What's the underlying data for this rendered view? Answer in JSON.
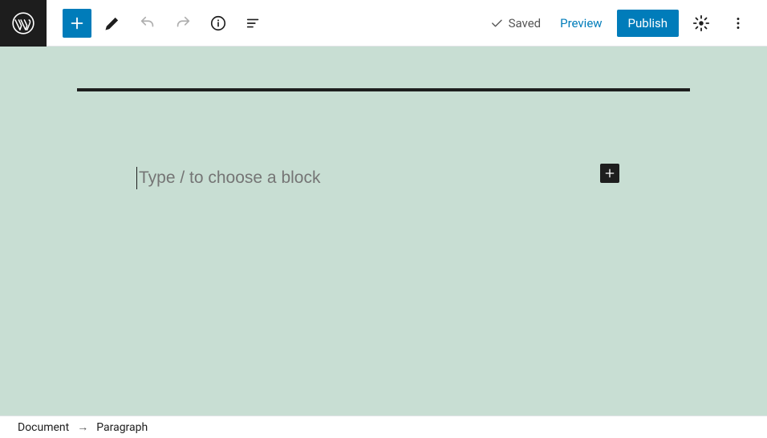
{
  "toolbar": {
    "saved_label": "Saved",
    "preview_label": "Preview",
    "publish_label": "Publish"
  },
  "editor": {
    "paragraph_placeholder": "Type / to choose a block"
  },
  "breadcrumb": {
    "root": "Document",
    "current": "Paragraph",
    "separator": "→"
  }
}
